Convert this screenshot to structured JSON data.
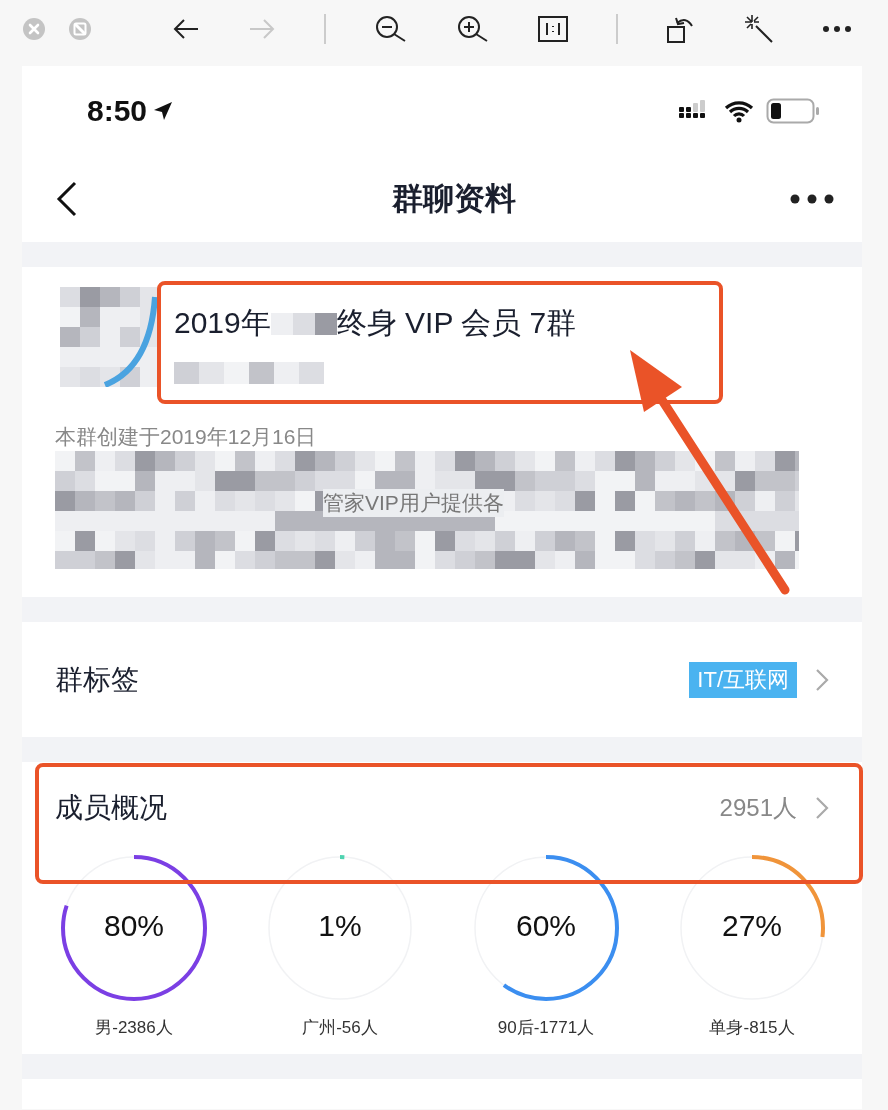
{
  "viewer_toolbar": {
    "forward_disabled": true
  },
  "status_bar": {
    "time": "8:50"
  },
  "nav_bar": {
    "title": "群聊资料"
  },
  "group": {
    "name_start": "2019年",
    "name_end": "终身 VIP 会员 7群",
    "created": "本群创建于2019年12月16日",
    "description_fragment": "管家VIP用户提供各"
  },
  "tag_row": {
    "label": "群标签",
    "tag": "IT/互联网"
  },
  "members": {
    "label": "成员概况",
    "count": "2951人",
    "stats": [
      {
        "percent": "80%",
        "caption": "男-2386人",
        "level": 0.8,
        "color": "#7b3fe4"
      },
      {
        "percent": "1%",
        "caption": "广州-56人",
        "level": 0.01,
        "color": "#4fd3b0"
      },
      {
        "percent": "60%",
        "caption": "90后-1771人",
        "level": 0.6,
        "color": "#3b8ef0"
      },
      {
        "percent": "27%",
        "caption": "单身-815人",
        "level": 0.27,
        "color": "#f0943a"
      }
    ]
  },
  "annotations": [
    {
      "kind": "box"
    },
    {
      "kind": "box"
    },
    {
      "kind": "arrow"
    }
  ]
}
